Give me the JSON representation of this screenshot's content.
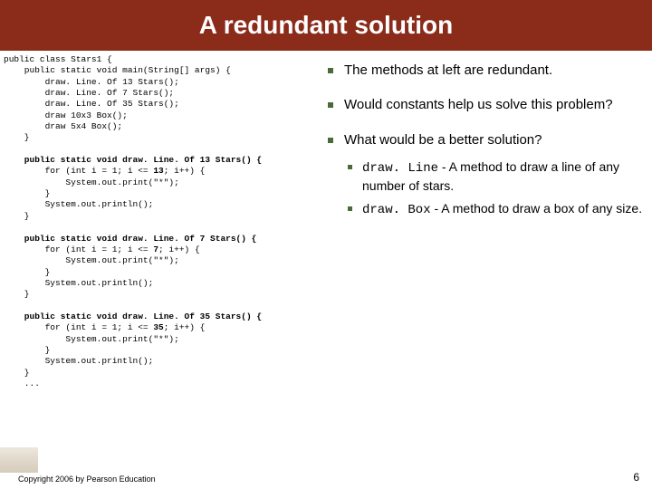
{
  "title": "A redundant solution",
  "code": {
    "l1": "public class Stars1 {",
    "l2": "    public static void main(String[] args) {",
    "l3": "        draw. Line. Of 13 Stars();",
    "l4": "        draw. Line. Of 7 Stars();",
    "l5": "        draw. Line. Of 35 Stars();",
    "l6": "        draw 10x3 Box();",
    "l7": "        draw 5x4 Box();",
    "l8": "    }",
    "m13a": "    public static void draw. Line. Of 13 Stars() {",
    "m13b": "        for (int i = 1; i <= ",
    "m13n": "13",
    "m13c": "; i++) {",
    "m13d": "            System.out.print(\"*\");",
    "m13e": "        }",
    "m13f": "        System.out.println();",
    "m13g": "    }",
    "m7a": "    public static void draw. Line. Of 7 Stars() {",
    "m7b": "        for (int i = 1; i <= ",
    "m7n": "7",
    "m7c": "; i++) {",
    "m7d": "            System.out.print(\"*\");",
    "m7e": "        }",
    "m7f": "        System.out.println();",
    "m7g": "    }",
    "m35a": "    public static void draw. Line. Of 35 Stars() {",
    "m35b": "        for (int i = 1; i <= ",
    "m35n": "35",
    "m35c": "; i++) {",
    "m35d": "            System.out.print(\"*\");",
    "m35e": "        }",
    "m35f": "        System.out.println();",
    "m35g": "    }",
    "ell": "    ..."
  },
  "bullets": {
    "b1": "The methods at left are redundant.",
    "b2": "Would constants help us solve this problem?",
    "b3": "What would be a better solution?",
    "sub1a": "draw. Line",
    "sub1b": " - A method to draw a line of any number of stars.",
    "sub2a": "draw. Box",
    "sub2b": " - A method to draw a box of any size."
  },
  "footer": "Copyright 2006 by Pearson Education",
  "page": "6"
}
